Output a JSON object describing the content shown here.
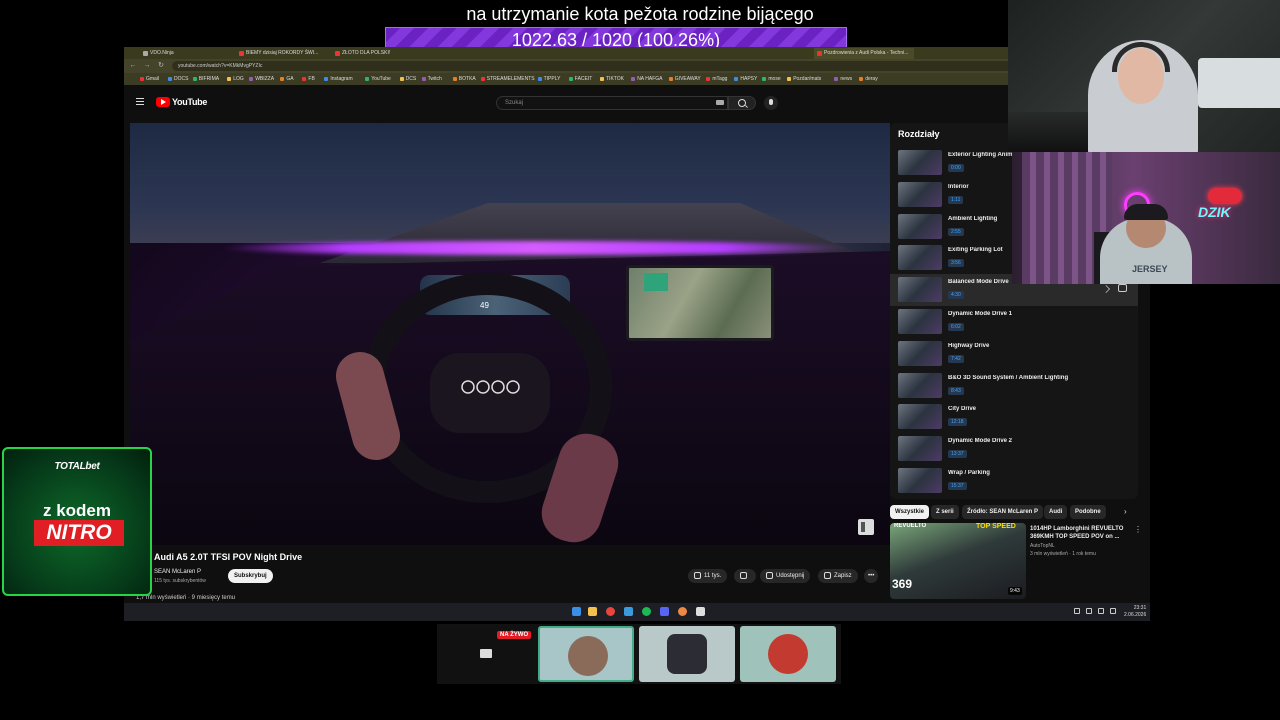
{
  "overlay": {
    "goal_title": "na utrzymanie kota pežota rodzine bijącego",
    "goal_value": "1022.63 / 1020 (100.26%)",
    "goal_progress": 1.0,
    "goal_color": "#8238dc"
  },
  "browser": {
    "tabs": [
      "VDO.Ninja",
      "BIEMY dzisiaj ROKORDY ŚWI...",
      "ZŁOTO DLA POLSKI!",
      "Pozdrowienia z Audi Polska - Techni..."
    ],
    "url": "youtube.com/watch?v=KMkMvgPYZIc",
    "bookmarks": [
      "Gmail",
      "DOCS",
      "BIFRIMA",
      "LOG",
      "WBIZZA",
      "GA",
      "FB",
      "Instagram",
      "YouTube",
      "DCS",
      "Twitch",
      "BOTKA",
      "STREAMELEMENTS",
      "TIPPLY",
      "FACEIT",
      "TIKTOK",
      "NA HAFGA",
      "GIVEAWAY",
      "mTagg",
      "HAPSY",
      "mose",
      "Pozdar/mats",
      "news",
      "deray"
    ]
  },
  "youtube": {
    "logo_text": "YouTube",
    "search_placeholder": "Szukaj",
    "video": {
      "cluster_speed": "49",
      "title": "Audi A5 2.0T TFSI POV Night Drive",
      "channel": "SEAN McLaren P",
      "subscribers": "115 tys. subskrybentów",
      "subscribe_label": "Subskrybuj",
      "likes": "11 tys.",
      "share_label": "Udostępnij",
      "save_label": "Zapisz",
      "more_label": "•••",
      "views_line": "1,7 mln wyświetleń · 9 miesięcy temu"
    },
    "chapters": {
      "title": "Rozdziały",
      "items": [
        {
          "title": "Exterior Lighting Animation",
          "time": "0:00"
        },
        {
          "title": "Interior",
          "time": "1:11"
        },
        {
          "title": "Ambient Lighting",
          "time": "2:55"
        },
        {
          "title": "Exiting Parking Lot",
          "time": "3:56"
        },
        {
          "title": "Balanced Mode Drive",
          "time": "4:30"
        },
        {
          "title": "Dynamic Mode Drive 1",
          "time": "6:02"
        },
        {
          "title": "Highway Drive",
          "time": "7:42"
        },
        {
          "title": "B&O 3D Sound System / Ambient Lighting Colors",
          "time": "8:43"
        },
        {
          "title": "City Drive",
          "time": "12:18"
        },
        {
          "title": "Dynamic Mode Drive 2",
          "time": "13:37"
        },
        {
          "title": "Wrap / Parking",
          "time": "15:37"
        }
      ],
      "active_index": 4
    },
    "chips": [
      "Wszystkie",
      "Z serii",
      "Źródło: SEAN McLaren P",
      "Audi",
      "Podobne"
    ],
    "recommended": {
      "badge_left": "REVUELTO",
      "badge_right": "TOP SPEED",
      "speed": "369",
      "duration": "9:43",
      "title": "1014HP Lamborghini REVUELTO 369KMH TOP SPEED POV on ...",
      "channel": "AutoTopNL",
      "meta": "3 mln wyświetleń · 1 rok temu"
    }
  },
  "taskbar": {
    "time": "23:31",
    "date": "2.06.2026"
  },
  "webcam": {
    "shirt_text": "JERSEY",
    "logo_text": "DZIK"
  },
  "promo": {
    "brand": "TOTALbet",
    "line": "z kodem",
    "code": "NITRO"
  },
  "participants": {
    "live_badge": "NA ŻYWO"
  }
}
